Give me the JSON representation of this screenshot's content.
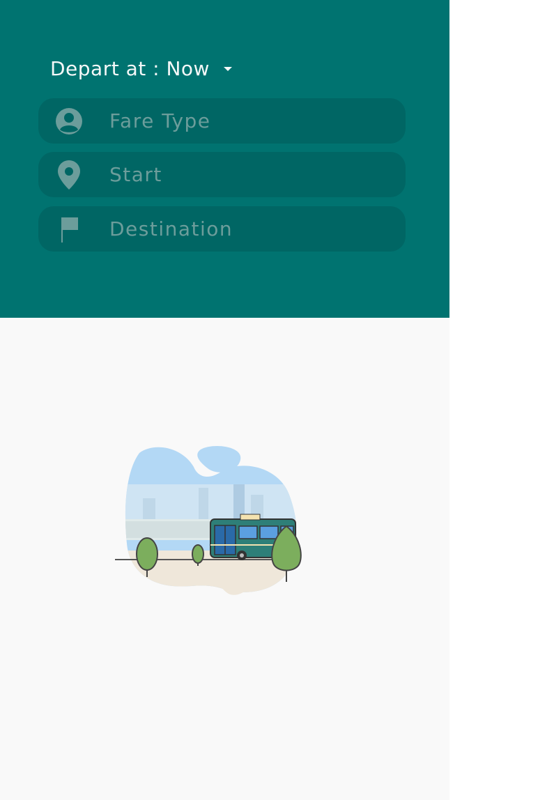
{
  "header": {
    "depart_label": "Depart at : Now",
    "background_color": "#007370"
  },
  "fields": {
    "fare_type": {
      "placeholder": "Fare Type",
      "icon": "person-icon"
    },
    "start": {
      "placeholder": "Start",
      "icon": "location-pin-icon"
    },
    "destination": {
      "placeholder": "Destination",
      "icon": "flag-icon"
    }
  },
  "illustration": {
    "name": "bus-illustration",
    "colors": {
      "sky": "#b3d8f5",
      "bus": "#2e7f78",
      "tree": "#7cae5d",
      "ground": "#efe7da"
    }
  }
}
